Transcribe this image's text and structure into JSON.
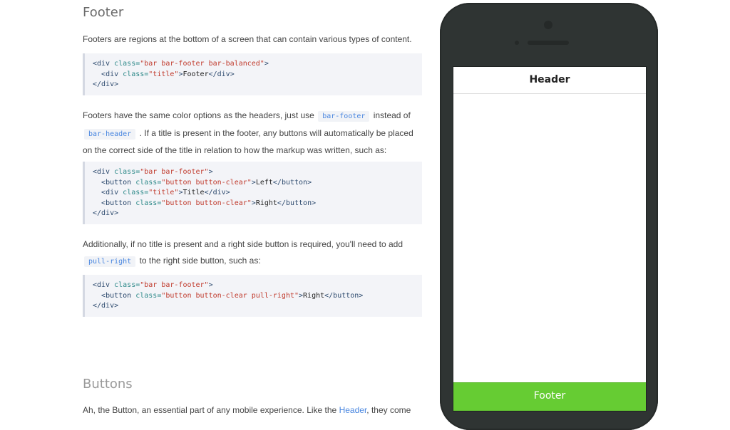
{
  "docs": {
    "section_title": "Footer",
    "intro": "Footers are regions at the bottom of a screen that can contain various types of content.",
    "code1": [
      [
        {
          "c": "tg",
          "t": "<div "
        },
        {
          "c": "at",
          "t": "class="
        },
        {
          "c": "st",
          "t": "\"bar bar-footer bar-balanced\""
        },
        {
          "c": "tg",
          "t": ">"
        }
      ],
      [
        {
          "c": "tx",
          "t": "  "
        },
        {
          "c": "tg",
          "t": "<div "
        },
        {
          "c": "at",
          "t": "class="
        },
        {
          "c": "st",
          "t": "\"title\""
        },
        {
          "c": "tg",
          "t": ">"
        },
        {
          "c": "tx",
          "t": "Footer"
        },
        {
          "c": "tg",
          "t": "</div>"
        }
      ],
      [
        {
          "c": "tg",
          "t": "</div>"
        }
      ]
    ],
    "para2": {
      "a": "Footers have the same color options as the headers, just use",
      "code_a": "bar-footer",
      "b": "instead of",
      "code_b": "bar-header",
      "c": ". If a title is present in the footer, any buttons will automatically be placed on the correct side of the title in relation to how the markup was written, such as:"
    },
    "code2": [
      [
        {
          "c": "tg",
          "t": "<div "
        },
        {
          "c": "at",
          "t": "class="
        },
        {
          "c": "st",
          "t": "\"bar bar-footer\""
        },
        {
          "c": "tg",
          "t": ">"
        }
      ],
      [
        {
          "c": "tx",
          "t": "  "
        },
        {
          "c": "tg",
          "t": "<button "
        },
        {
          "c": "at",
          "t": "class="
        },
        {
          "c": "st",
          "t": "\"button button-clear\""
        },
        {
          "c": "tg",
          "t": ">"
        },
        {
          "c": "tx",
          "t": "Left"
        },
        {
          "c": "tg",
          "t": "</button>"
        }
      ],
      [
        {
          "c": "tx",
          "t": "  "
        },
        {
          "c": "tg",
          "t": "<div "
        },
        {
          "c": "at",
          "t": "class="
        },
        {
          "c": "st",
          "t": "\"title\""
        },
        {
          "c": "tg",
          "t": ">"
        },
        {
          "c": "tx",
          "t": "Title"
        },
        {
          "c": "tg",
          "t": "</div>"
        }
      ],
      [
        {
          "c": "tx",
          "t": "  "
        },
        {
          "c": "tg",
          "t": "<button "
        },
        {
          "c": "at",
          "t": "class="
        },
        {
          "c": "st",
          "t": "\"button button-clear\""
        },
        {
          "c": "tg",
          "t": ">"
        },
        {
          "c": "tx",
          "t": "Right"
        },
        {
          "c": "tg",
          "t": "</button>"
        }
      ],
      [
        {
          "c": "tg",
          "t": "</div>"
        }
      ]
    ],
    "para3": {
      "a": "Additionally, if no title is present and a right side button is required, you'll need to add",
      "code_a": "pull-right",
      "b": "to the right side button, such as:"
    },
    "code3": [
      [
        {
          "c": "tg",
          "t": "<div "
        },
        {
          "c": "at",
          "t": "class="
        },
        {
          "c": "st",
          "t": "\"bar bar-footer\""
        },
        {
          "c": "tg",
          "t": ">"
        }
      ],
      [
        {
          "c": "tx",
          "t": "  "
        },
        {
          "c": "tg",
          "t": "<button "
        },
        {
          "c": "at",
          "t": "class="
        },
        {
          "c": "st",
          "t": "\"button button-clear pull-right\""
        },
        {
          "c": "tg",
          "t": ">"
        },
        {
          "c": "tx",
          "t": "Right"
        },
        {
          "c": "tg",
          "t": "</button>"
        }
      ],
      [
        {
          "c": "tg",
          "t": "</div>"
        }
      ]
    ],
    "next_title": "Buttons",
    "next_para": {
      "a": "Ah, the Button, an essential part of any mobile experience. Like the",
      "link": "Header",
      "b": ", they come"
    }
  },
  "phone": {
    "header_title": "Header",
    "footer_title": "Footer",
    "colors": {
      "footer_bg": "#66cc33",
      "body": "#2f3433"
    }
  }
}
